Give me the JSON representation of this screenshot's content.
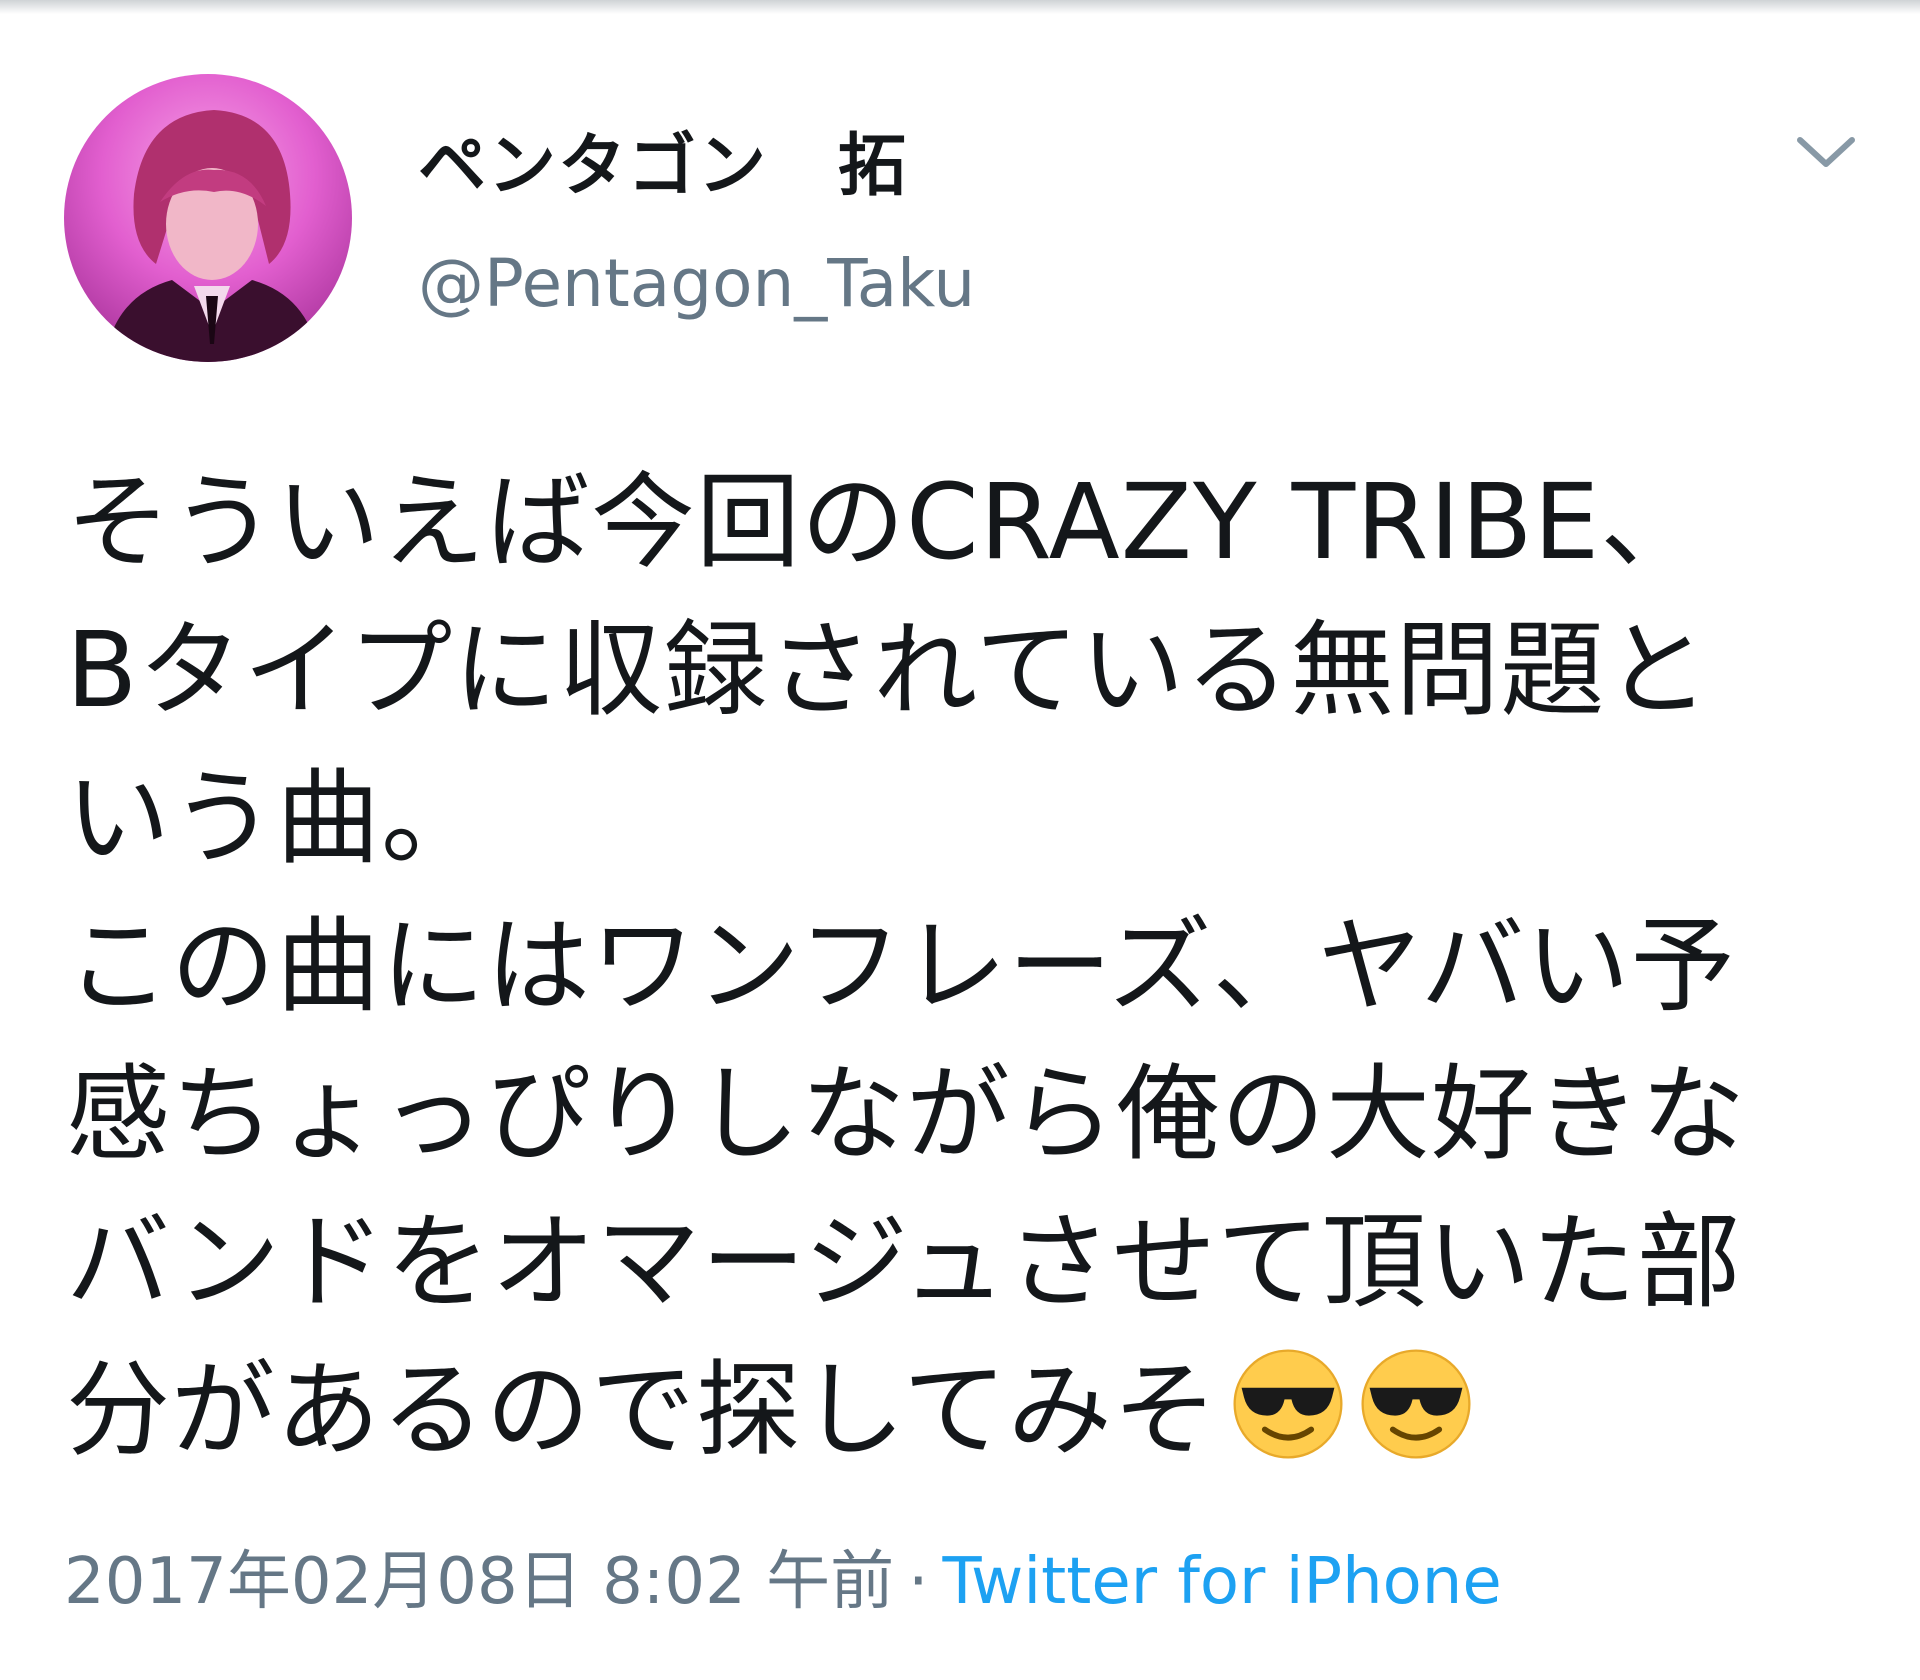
{
  "tweet": {
    "author": {
      "display_name": "ペンタゴン　拓",
      "handle": "@Pentagon_Taku"
    },
    "text_lines": [
      "そういえば今回のCRAZY TRIBE、",
      "Bタイプに収録されている無問題と",
      "いう曲。",
      "この曲にはワンフレーズ、ヤバい予",
      "感ちょっぴりしながら俺の大好きな",
      "バンドをオマージュさせて頂いた部",
      "分があるので探してみそ"
    ],
    "emojis": [
      "smiling-face-with-sunglasses",
      "smiling-face-with-sunglasses"
    ],
    "timestamp": "2017年02月08日 8:02 午前",
    "separator": "·",
    "source": "Twitter for iPhone"
  },
  "colors": {
    "text": "#14171a",
    "secondary": "#657786",
    "link": "#1da1f2",
    "avatar_bg": "#e25fcf"
  },
  "icons": {
    "more": "chevron-down-icon"
  }
}
